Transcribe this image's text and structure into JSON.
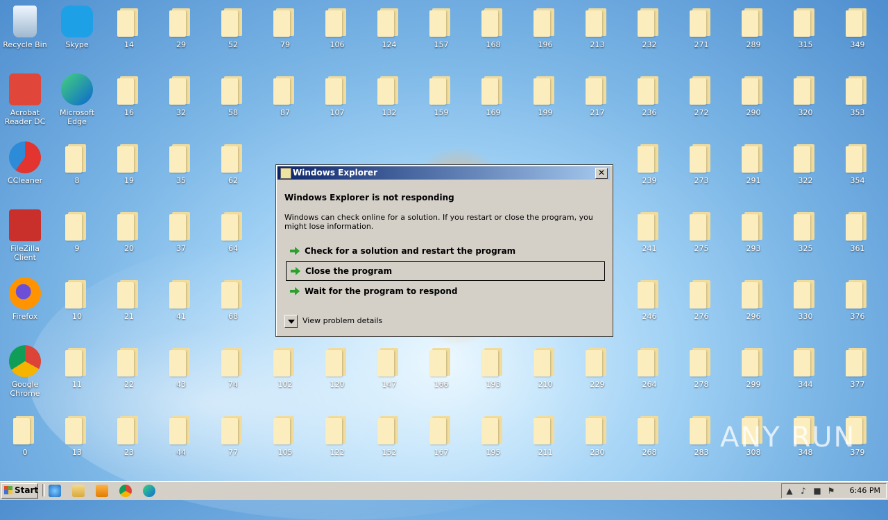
{
  "desktop": {
    "icons": [
      {
        "label": "Recycle Bin",
        "type": "recycle"
      },
      {
        "label": "Skype",
        "type": "skype"
      },
      {
        "label": "Acrobat Reader DC",
        "type": "acrobat"
      },
      {
        "label": "Microsoft Edge",
        "type": "edge"
      },
      {
        "label": "CCleaner",
        "type": "ccleaner"
      },
      {
        "label": "FileZilla Client",
        "type": "filezilla"
      },
      {
        "label": "Firefox",
        "type": "firefox"
      },
      {
        "label": "Google Chrome",
        "type": "chrome"
      }
    ],
    "folders": [
      "14",
      "29",
      "52",
      "79",
      "106",
      "124",
      "157",
      "168",
      "196",
      "213",
      "232",
      "271",
      "289",
      "315",
      "349",
      "16",
      "32",
      "58",
      "87",
      "107",
      "132",
      "159",
      "169",
      "199",
      "217",
      "236",
      "272",
      "290",
      "320",
      "353",
      "8",
      "19",
      "35",
      "62",
      "239",
      "273",
      "291",
      "322",
      "354",
      "9",
      "20",
      "37",
      "64",
      "241",
      "275",
      "293",
      "325",
      "361",
      "10",
      "21",
      "41",
      "68",
      "246",
      "276",
      "296",
      "330",
      "376",
      "11",
      "22",
      "43",
      "74",
      "102",
      "120",
      "147",
      "166",
      "193",
      "210",
      "229",
      "264",
      "278",
      "299",
      "344",
      "377",
      "0",
      "13",
      "23",
      "44",
      "77",
      "105",
      "122",
      "152",
      "167",
      "195",
      "211",
      "230",
      "268",
      "283",
      "308",
      "348",
      "379"
    ],
    "watermark": "ANY RUN"
  },
  "dialog": {
    "title": "Windows Explorer",
    "heading": "Windows Explorer is not responding",
    "description": "Windows can check online for a solution. If you restart or close the program, you might lose information.",
    "options": [
      {
        "label": "Check for a solution and restart the program",
        "selected": false
      },
      {
        "label": "Close the program",
        "selected": true
      },
      {
        "label": "Wait for the program to respond",
        "selected": false
      }
    ],
    "details_label": "View problem details",
    "close_glyph": "✕"
  },
  "taskbar": {
    "start_label": "Start",
    "quick_launch": [
      "ie-icon",
      "explorer-icon",
      "media-player-icon",
      "chrome-icon",
      "edge-icon"
    ],
    "tray_icons": [
      "chevron-up-icon",
      "volume-icon",
      "network-icon",
      "flag-icon"
    ],
    "clock": "6:46 PM"
  },
  "colors": {
    "title_gradient_start": "#0a246a",
    "title_gradient_end": "#a6caf0",
    "dialog_bg": "#d4d0c8",
    "arrow_green": "#2ba12b"
  }
}
